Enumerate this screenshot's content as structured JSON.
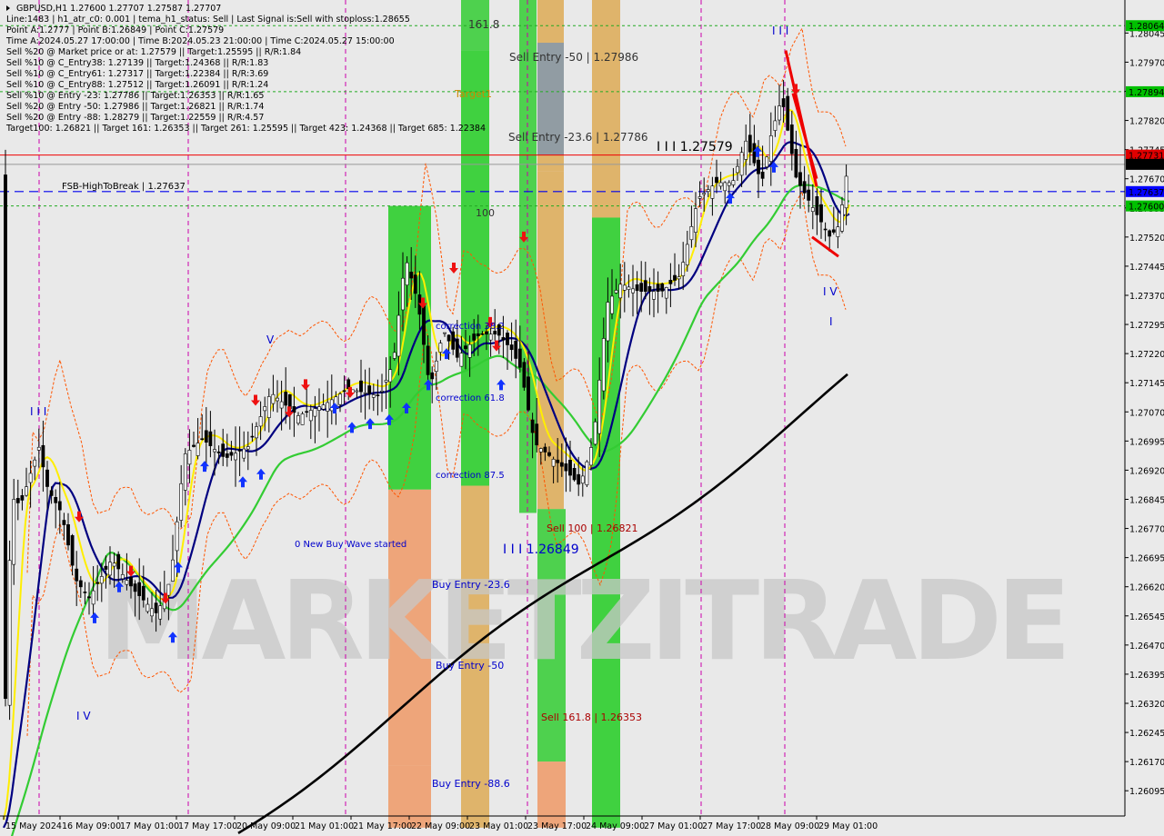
{
  "chart_data": {
    "type": "candlestick",
    "title": "GBPUSD,H1  1.27600 1.27707 1.27587 1.27707",
    "ylim": [
      1.2603,
      1.2813
    ],
    "y_ticks": [
      1.28045,
      1.2797,
      1.27895,
      1.2782,
      1.27745,
      1.2767,
      1.27595,
      1.2752,
      1.27445,
      1.2737,
      1.27295,
      1.2722,
      1.27145,
      1.2707,
      1.26995,
      1.2692,
      1.26845,
      1.2677,
      1.26695,
      1.2662,
      1.26545,
      1.2647,
      1.26395,
      1.2632,
      1.26245,
      1.2617,
      1.26095
    ],
    "x_ticks": [
      "15 May 2024",
      "16 May 09:00",
      "17 May 01:00",
      "17 May 17:00",
      "20 May 09:00",
      "21 May 01:00",
      "21 May 17:00",
      "22 May 09:00",
      "23 May 01:00",
      "23 May 17:00",
      "24 May 09:00",
      "27 May 01:00",
      "27 May 17:00",
      "28 May 09:00",
      "29 May 01:00"
    ],
    "info_lines": [
      "GBPUSD,H1  1.27600 1.27707 1.27587 1.27707",
      "Line:1483  |  h1_atr_c0: 0.001  |  tema_h1_status: Sell  |  Last Signal is:Sell with stoploss:1.28655",
      "Point A:1.2777  |  Point B:1.26849  |  Point C:1.27579",
      "Time A:2024.05.27 17:00:00  |  Time B:2024.05.23 21:00:00  |  Time C:2024.05.27 15:00:00",
      "Sell %20 @ Market price or at: 1.27579  ||  Target:1.25595  ||  R/R:1.84",
      "Sell %10 @ C_Entry38: 1.27139  ||  Target:1.24368  ||  R/R:1.83",
      "Sell %10 @ C_Entry61: 1.27317  ||  Target:1.22384  ||  R/R:3.69",
      "Sell %10 @ C_Entry88: 1.27512  ||  Target:1.26091  ||  R/R:1.24",
      "Sell %10 @ Entry -23: 1.27786  ||  Target:1.26353  ||  R/R:1.65",
      "Sell %20 @ Entry -50: 1.27986  ||  Target:1.26821  ||  R/R:1.74",
      "Sell %20 @ Entry -88: 1.28279  ||  Target:1.22559  ||  R/R:4.57",
      "Target100: 1.26821  ||  Target 161: 1.26353  ||  Target 261: 1.25595  ||  Target 423: 1.24368  ||  Target 685: 1.22384"
    ],
    "price_boxes": [
      {
        "value": 1.28064,
        "label": "1.28064",
        "color": "#00c000"
      },
      {
        "value": 1.27894,
        "label": "1.27894",
        "color": "#00c000"
      },
      {
        "value": 1.27731,
        "label": "1.27731",
        "color": "#e00000"
      },
      {
        "value": 1.27707,
        "label": "1.27707",
        "color": "#000000"
      },
      {
        "value": 1.27637,
        "label": "1.27637",
        "color": "#0000ff"
      },
      {
        "value": 1.276,
        "label": "1.27600",
        "color": "#00c000"
      }
    ],
    "annotations": [
      {
        "text": "161.8",
        "color": "#333333"
      },
      {
        "text": "Sell Entry -50 | 1.27986",
        "color": "#333333"
      },
      {
        "text": "Target1",
        "color": "#cc8800"
      },
      {
        "text": "Sell Entry -23.6 | 1.27786",
        "color": "#333333"
      },
      {
        "text": "I I I 1.27579",
        "color": "#000000"
      },
      {
        "text": "FSB-HighToBreak | 1.27637",
        "color": "#000000"
      },
      {
        "text": "100",
        "color": "#333333"
      },
      {
        "text": "correction 38.2",
        "color": "#0000cc"
      },
      {
        "text": "correction 61.8",
        "color": "#0000cc"
      },
      {
        "text": "correction 87.5",
        "color": "#0000cc"
      },
      {
        "text": "0 New Buy Wave started",
        "color": "#0000cc"
      },
      {
        "text": "Sell 100 | 1.26821",
        "color": "#aa0000"
      },
      {
        "text": "I I I 1.26849",
        "color": "#0000cc"
      },
      {
        "text": "Buy Entry -23.6",
        "color": "#0000cc"
      },
      {
        "text": "Buy Entry -50",
        "color": "#0000cc"
      },
      {
        "text": "Sell 161.8 | 1.26353",
        "color": "#aa0000"
      },
      {
        "text": "Buy Entry -88.6",
        "color": "#0000cc"
      },
      {
        "text": "I I I",
        "color": "#0000cc"
      },
      {
        "text": "V",
        "color": "#0000cc"
      },
      {
        "text": "I V",
        "color": "#0000cc"
      },
      {
        "text": "I I I",
        "color": "#0000cc"
      },
      {
        "text": "I V",
        "color": "#0000cc"
      },
      {
        "text": "I",
        "color": "#0000cc"
      }
    ],
    "watermark": "MARKETZITRADE",
    "colors": {
      "bull": "#00aa00",
      "bear": "#000000",
      "ma_fast": "#ffff00",
      "ma_mid": "#000080",
      "ma_slow": "#33cc33",
      "ma_long": "#000000",
      "envelope": "#ff4400"
    }
  }
}
